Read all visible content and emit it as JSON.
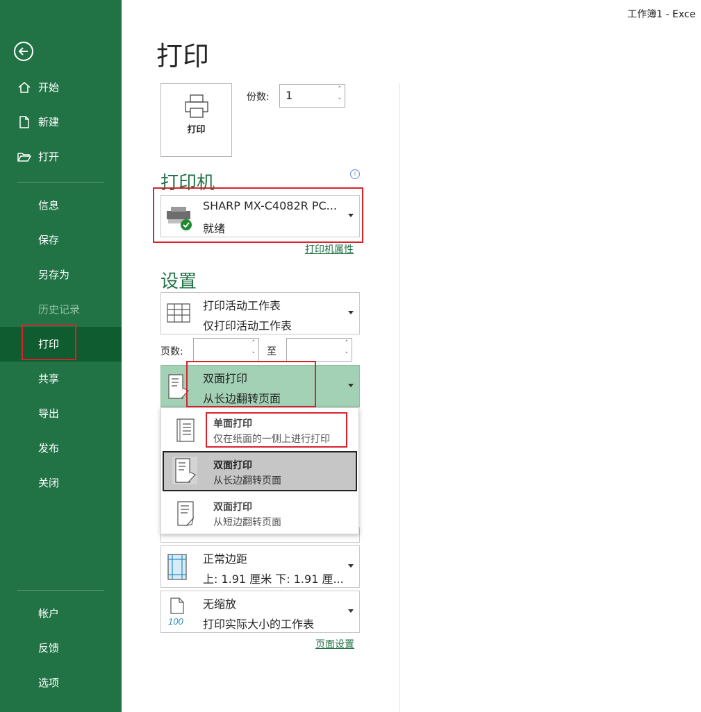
{
  "window": {
    "title": "工作簿1  -  Exce"
  },
  "sidebar": {
    "items": [
      {
        "label": "开始"
      },
      {
        "label": "新建"
      },
      {
        "label": "打开"
      },
      {
        "label": "信息"
      },
      {
        "label": "保存"
      },
      {
        "label": "另存为"
      },
      {
        "label": "历史记录"
      },
      {
        "label": "打印"
      },
      {
        "label": "共享"
      },
      {
        "label": "导出"
      },
      {
        "label": "发布"
      },
      {
        "label": "关闭"
      },
      {
        "label": "帐户"
      },
      {
        "label": "反馈"
      },
      {
        "label": "选项"
      }
    ]
  },
  "page": {
    "title": "打印"
  },
  "print_button": {
    "label": "打印"
  },
  "copies": {
    "label": "份数:",
    "value": "1"
  },
  "printer": {
    "heading": "打印机",
    "name": "SHARP MX-C4082R PC...",
    "status": "就绪",
    "properties_link": "打印机属性"
  },
  "settings": {
    "heading": "设置",
    "scope": {
      "title": "打印活动工作表",
      "desc": "仅打印活动工作表"
    },
    "pages": {
      "label": "页数:",
      "to": "至"
    },
    "duplex": {
      "title": "双面打印",
      "desc": "从长边翻转页面"
    },
    "duplex_options": [
      {
        "title": "单面打印",
        "desc": "仅在纸面的一侧上进行打印"
      },
      {
        "title": "双面打印",
        "desc": "从长边翻转页面"
      },
      {
        "title": "双面打印",
        "desc": "从短边翻转页面"
      }
    ],
    "margins": {
      "title": "正常边距",
      "desc": "上: 1.91 厘米 下: 1.91 厘..."
    },
    "scaling": {
      "title": "无缩放",
      "desc": "打印实际大小的工作表",
      "icon_text": "100"
    },
    "page_setup_link": "页面设置"
  },
  "colors": {
    "accent": "#217346",
    "sidebar_active": "#0e5c2f",
    "highlight": "#d9232c"
  }
}
